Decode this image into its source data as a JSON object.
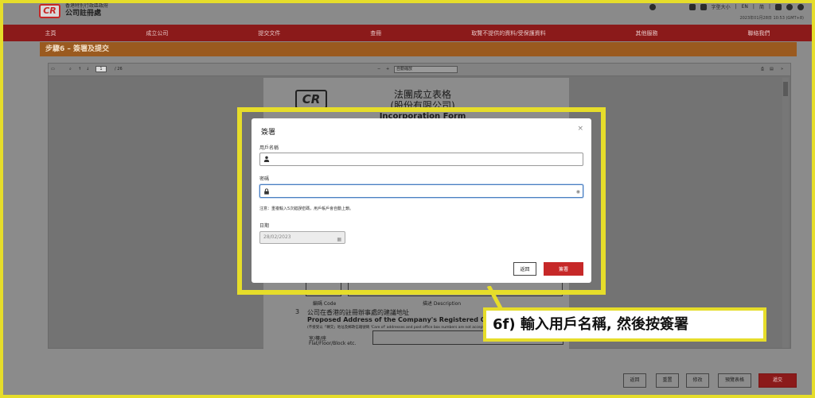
{
  "header": {
    "logo_text": "CR",
    "org_line1": "香港特別行政區政府",
    "org_line2": "公司註冊處",
    "font_size_label": "字型大小",
    "lang_en": "EN",
    "lang_sc": "简",
    "datetime": "2023年01月28日 10:53 (GMT+8)"
  },
  "nav": {
    "items": [
      "主頁",
      "成立公司",
      "提交文件",
      "查冊",
      "取覽不提供的資料/受保護資料",
      "其他服務",
      "聯絡我們"
    ]
  },
  "step": {
    "title": "步驟6 – 簽署及提交"
  },
  "viewer": {
    "page_current": "1",
    "page_total": "/ 26",
    "zoom": "自動縮放"
  },
  "document": {
    "logo_text": "CR",
    "title_zh_1": "法團成立表格",
    "title_zh_2": "(股份有限公司)",
    "title_en": "Incorporation Form",
    "code_label": "編碼 Code",
    "desc_label": "描述 Description",
    "section_no": "3",
    "section_zh": "公司在香港的註冊辦事處的建議地址",
    "section_en": "Proposed Address of the Company's Registered Office in Hong Kong",
    "section_sub": "(不接受以「轉交」地址及郵政信箱號碼 'Care of' addresses and post office box numbers are not acceptable)",
    "flat_label": "室/樓/座",
    "flat_label_en": "Flat/Floor/Block etc."
  },
  "modal": {
    "title": "簽署",
    "close": "×",
    "username_label": "用戶名稱",
    "username_value": "",
    "password_label": "密碼",
    "password_value": "",
    "note": "注意：重複輸入5次錯誤密碼，用戶帳戶會自動上鎖。",
    "date_label": "日期",
    "date_value": "28/02/2023",
    "back_button": "返回",
    "sign_button": "簽署"
  },
  "callout": {
    "text": "6f) 輸入用戶名稱, 然後按簽署"
  },
  "bottom_buttons": [
    "返回",
    "重置",
    "修改",
    "預覽表格",
    "遞交"
  ]
}
